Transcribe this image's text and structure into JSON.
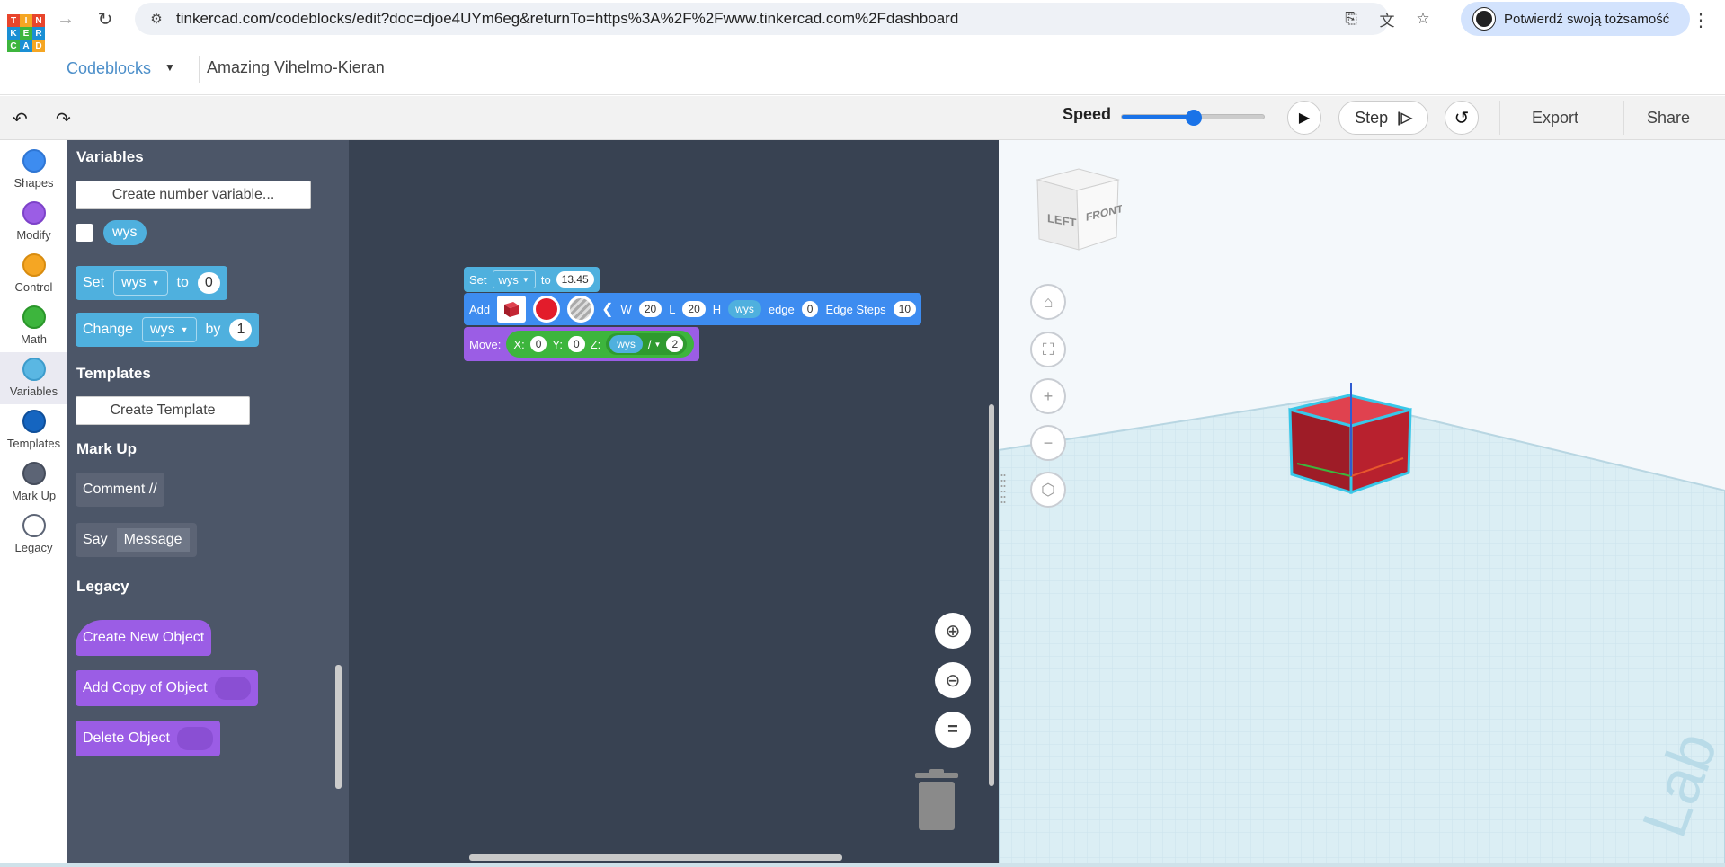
{
  "browser": {
    "url": "tinkercad.com/codeblocks/edit?doc=djoe4UYm6eg&returnTo=https%3A%2F%2Fwww.tinkercad.com%2Fdashboard",
    "profile_label": "Potwierdź swoją tożsamość"
  },
  "app": {
    "logo_letters": [
      "TIN",
      "KER",
      "CAD"
    ],
    "mode_label": "Codeblocks",
    "doc_title": "Amazing Vihelmo-Kieran"
  },
  "toolbar": {
    "speed_label": "Speed",
    "speed_value": 0.5,
    "step_label": "Step",
    "export_label": "Export",
    "share_label": "Share"
  },
  "categories": [
    {
      "label": "Shapes",
      "color": "#3d8cf0"
    },
    {
      "label": "Modify",
      "color": "#9b5de5"
    },
    {
      "label": "Control",
      "color": "#f5a623"
    },
    {
      "label": "Math",
      "color": "#3db53d"
    },
    {
      "label": "Variables",
      "color": "#5ab7e3"
    },
    {
      "label": "Templates",
      "color": "#1565c0"
    },
    {
      "label": "Mark Up",
      "color": "#5c6475"
    },
    {
      "label": "Legacy",
      "color": "#ffffff"
    }
  ],
  "flyout": {
    "variables_title": "Variables",
    "create_var_label": "Create number variable...",
    "var_name": "wys",
    "set_label": "Set",
    "to_label": "to",
    "set_value": "0",
    "change_label": "Change",
    "by_label": "by",
    "change_value": "1",
    "templates_title": "Templates",
    "create_template_label": "Create Template",
    "markup_title": "Mark Up",
    "comment_label": "Comment //",
    "say_label": "Say",
    "say_value": "Message",
    "legacy_title": "Legacy",
    "create_new_object_label": "Create New Object",
    "add_copy_label": "Add Copy of Object",
    "delete_object_label": "Delete Object"
  },
  "workspace": {
    "set_block": {
      "label": "Set",
      "var": "wys",
      "to": "to",
      "value": "13.45"
    },
    "add_block": {
      "label": "Add",
      "w_label": "W",
      "w": "20",
      "l_label": "L",
      "l": "20",
      "h_label": "H",
      "h_var": "wys",
      "edge_label": "edge",
      "edge": "0",
      "steps_label": "Edge Steps",
      "steps": "10"
    },
    "move_block": {
      "label": "Move:",
      "x_label": "X:",
      "x": "0",
      "y_label": "Y:",
      "y": "0",
      "z_label": "Z:",
      "z_var": "wys",
      "op": "/",
      "z_div": "2"
    }
  },
  "viewcube": {
    "left_label": "LEFT",
    "front_label": "FRONT"
  }
}
